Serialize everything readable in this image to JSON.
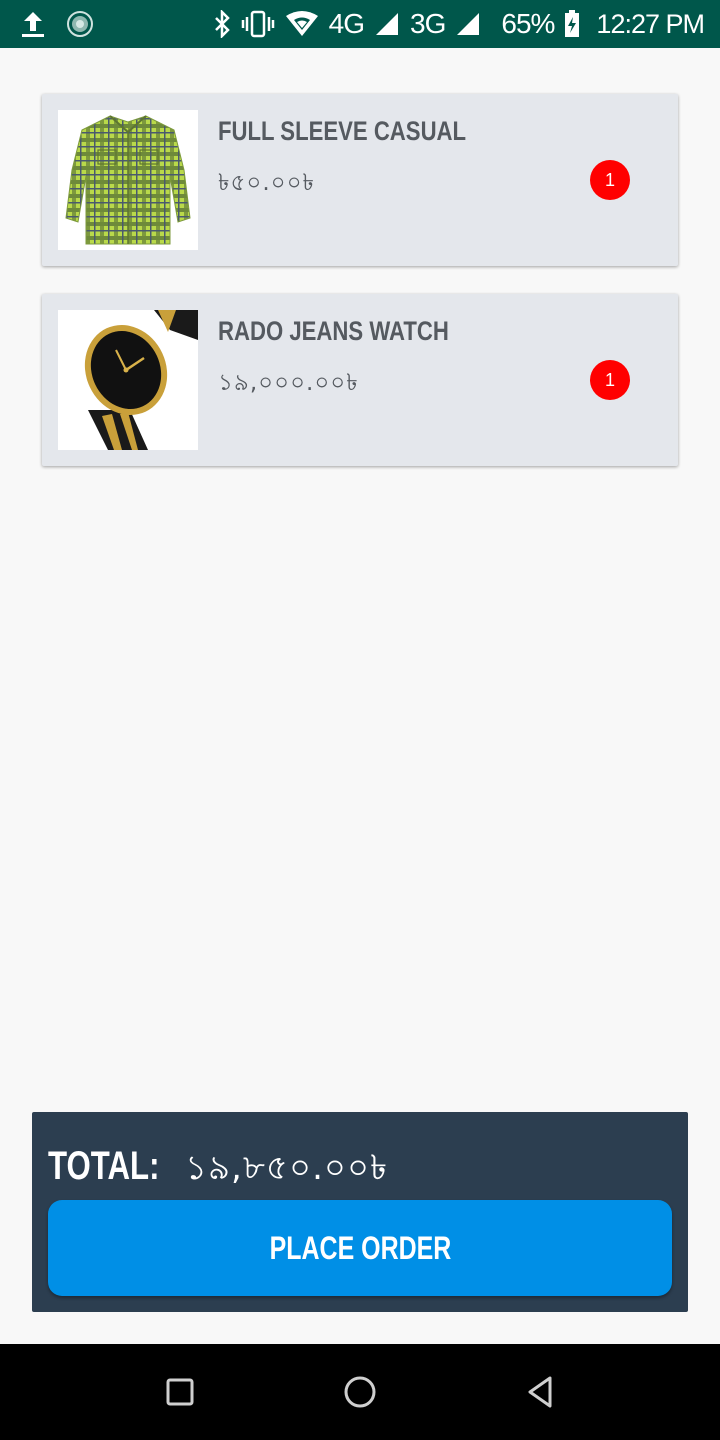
{
  "status_bar": {
    "network_4g": "4G",
    "network_3g": "3G",
    "battery": "65%",
    "time": "12:27 PM",
    "icons": [
      "upload-icon",
      "sync-icon",
      "bluetooth-icon",
      "vibrate-icon",
      "wifi-icon",
      "signal-icon",
      "battery-charging-icon"
    ]
  },
  "cart": {
    "items": [
      {
        "title": "FULL SLEEVE CASUAL",
        "price": "৳৫০.০০৳",
        "quantity": "1",
        "image": "checked-shirt"
      },
      {
        "title": "RADO JEANS WATCH",
        "price": "১৯,০০০.০০৳",
        "quantity": "1",
        "image": "black-gold-watch"
      }
    ]
  },
  "checkout": {
    "total_label": "TOTAL:",
    "total_value": "১৯,৮৫০.০০৳",
    "place_order_label": "PLACE ORDER"
  },
  "colors": {
    "status_bar": "#00574b",
    "card_bg": "#e4e7ec",
    "badge": "#ff0000",
    "panel": "#2c3e50",
    "button": "#008fe6"
  },
  "nav_bar": {
    "buttons": [
      "recents-icon",
      "home-icon",
      "back-icon"
    ]
  }
}
